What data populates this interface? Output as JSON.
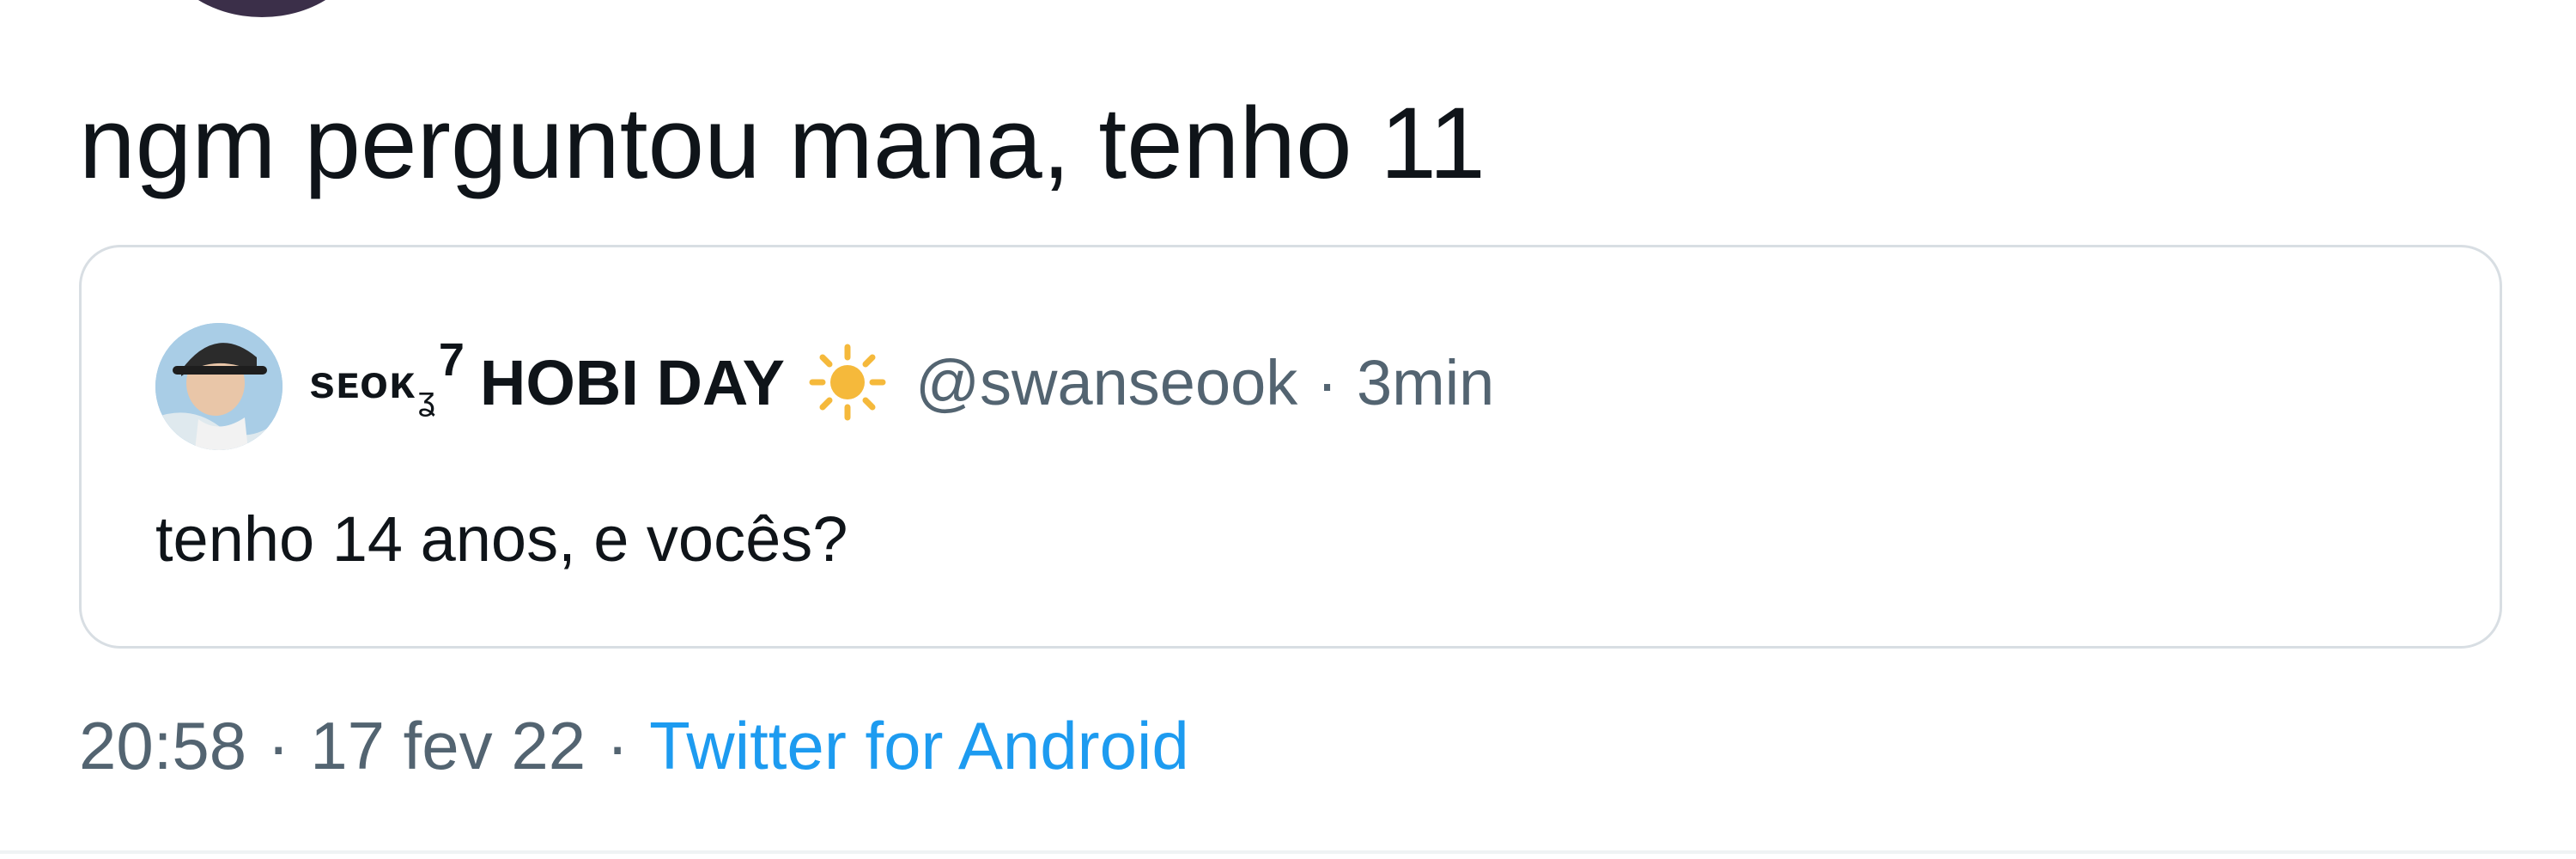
{
  "tweet": {
    "text": "ngm perguntou mana, tenho 11"
  },
  "quoted_tweet": {
    "display_name_prefix": "sᴇᴏᴋ",
    "display_name_sub": "ʓ",
    "display_name_sup": "7",
    "display_name_main": "HOBI DAY",
    "name_emoji": "sun-icon",
    "handle": "@swanseook",
    "separator": "·",
    "time_ago": "3min",
    "text": "tenho 14 anos, e vocês?"
  },
  "meta": {
    "time": "20:58",
    "separator": "·",
    "date": "17 fev 22",
    "separator2": "·",
    "source": "Twitter for Android"
  },
  "colors": {
    "text_primary": "#0f1419",
    "text_secondary": "#536471",
    "link": "#1d9bf0",
    "border": "#d8dee3",
    "sun": "#f5b93b"
  }
}
